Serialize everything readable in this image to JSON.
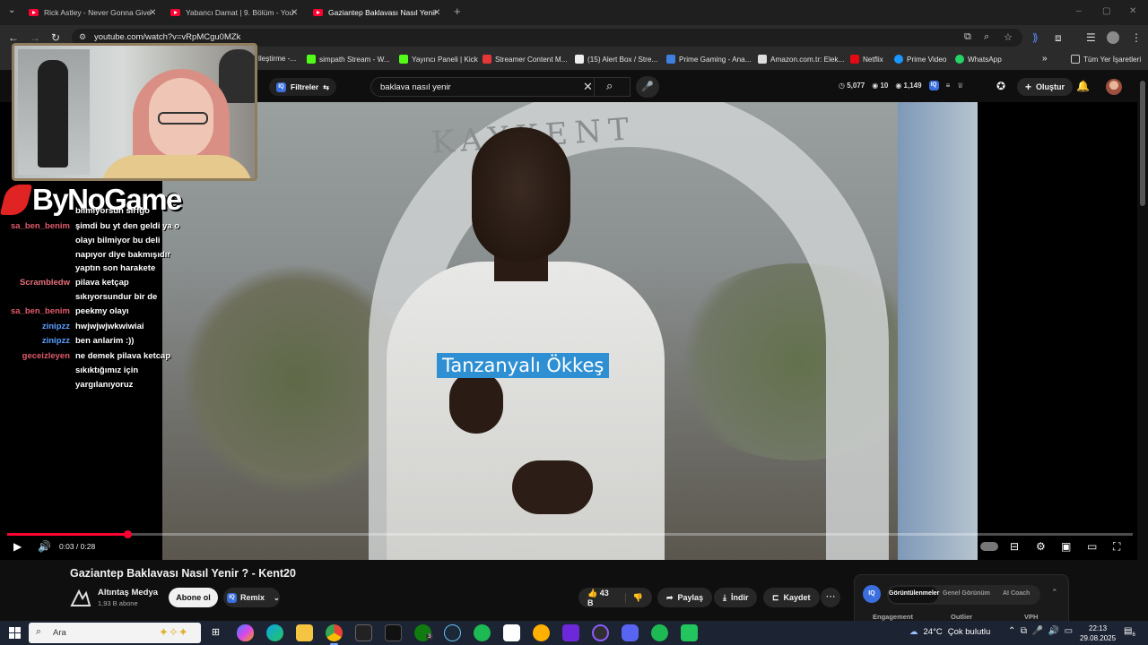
{
  "browser": {
    "tabs": [
      {
        "title": "Rick Astley - Never Gonna Give",
        "active": false
      },
      {
        "title": "Yabancı Damat | 9. Bölüm - You",
        "active": false
      },
      {
        "title": "Gaziantep Baklavası Nasıl Yenir",
        "active": true
      }
    ],
    "url": "youtube.com/watch?v=vRpMCgu0MZk",
    "bookmarks": [
      {
        "label": "lleştirme -...",
        "icon_color": "#444444"
      },
      {
        "label": "simpath Stream - W...",
        "icon_color": "#53fc18"
      },
      {
        "label": "Yayıncı Paneli | Kick",
        "icon_color": "#53fc18"
      },
      {
        "label": "Streamer Content M...",
        "icon_color": "#e5373a"
      },
      {
        "label": "(15) Alert Box / Stre...",
        "icon_color": "#eeeeee"
      },
      {
        "label": "Prime Gaming - Ana...",
        "icon_color": "#3f7fe0"
      },
      {
        "label": "Amazon.com.tr: Elek...",
        "icon_color": "#dddddd"
      },
      {
        "label": "Netflix",
        "icon_color": "#e50914"
      },
      {
        "label": "Prime Video",
        "icon_color": "#1a98ff"
      },
      {
        "label": "WhatsApp",
        "icon_color": "#25d366"
      }
    ],
    "all_bookmarks": "Tüm Yer İşaretleri"
  },
  "youtube": {
    "filters_label": "Filtreler",
    "search_query": "baklava nasıl yenir",
    "stats": {
      "views": "5,077",
      "a": "10",
      "b": "1,149"
    },
    "create_label": "Oluştur"
  },
  "overlay": {
    "brand": "ByNoGame",
    "chat": [
      {
        "user": "",
        "msg": "bilmiyorsun sirfgo",
        "color": "#ffffff"
      },
      {
        "user": "sa_ben_benim",
        "msg": "şimdi bu yt den geldi ya o olayı bilmiyor bu deli napıyor diye bakmışıdır yaptın son harakete",
        "color": "#e05a6a"
      },
      {
        "user": "Scrambledw",
        "msg": "pilava ketçap sıkıyorsundur bir de",
        "color": "#e8707a"
      },
      {
        "user": "sa_ben_benim",
        "msg": "peekmy olayı",
        "color": "#e05a6a"
      },
      {
        "user": "zinipzz",
        "msg": "hwjwjwjwkwiwiai",
        "color": "#5aa0ff"
      },
      {
        "user": "zinipzz",
        "msg": "ben anlarim :))",
        "color": "#5aa0ff"
      },
      {
        "user": "geceizleyen",
        "msg": "ne demek pilava ketcap sıkıktığımız için yargılanıyoruz",
        "color": "#e05a6a"
      }
    ]
  },
  "video": {
    "sign_text": "KAYKENT",
    "caption": "Tanzanyalı Ökkeş",
    "progress_fraction": 0.107,
    "timecode": "0:03 / 0:28",
    "title": "Gaziantep Baklavası Nasıl Yenir ? - Kent20",
    "channel_name": "Altıntaş Medya",
    "channel_subs": "1,93 B abone",
    "subscribe_label": "Abone ol",
    "remix_label": "Remix",
    "like_count": "43 B",
    "share_label": "Paylaş",
    "download_label": "İndir",
    "save_label": "Kaydet"
  },
  "iq_panel": {
    "logo": "IQ",
    "tabs": [
      "Görüntülenmeler",
      "Genel Görünüm",
      "AI Coach"
    ],
    "columns": [
      "Engagement",
      "Outlier",
      "VPH"
    ]
  },
  "taskbar": {
    "search_label": "Ara",
    "temperature": "24°C",
    "weather_text": "Çok bulutlu",
    "time": "22:13",
    "date": "29.08.2025",
    "notifications": "6",
    "badge": "3"
  }
}
